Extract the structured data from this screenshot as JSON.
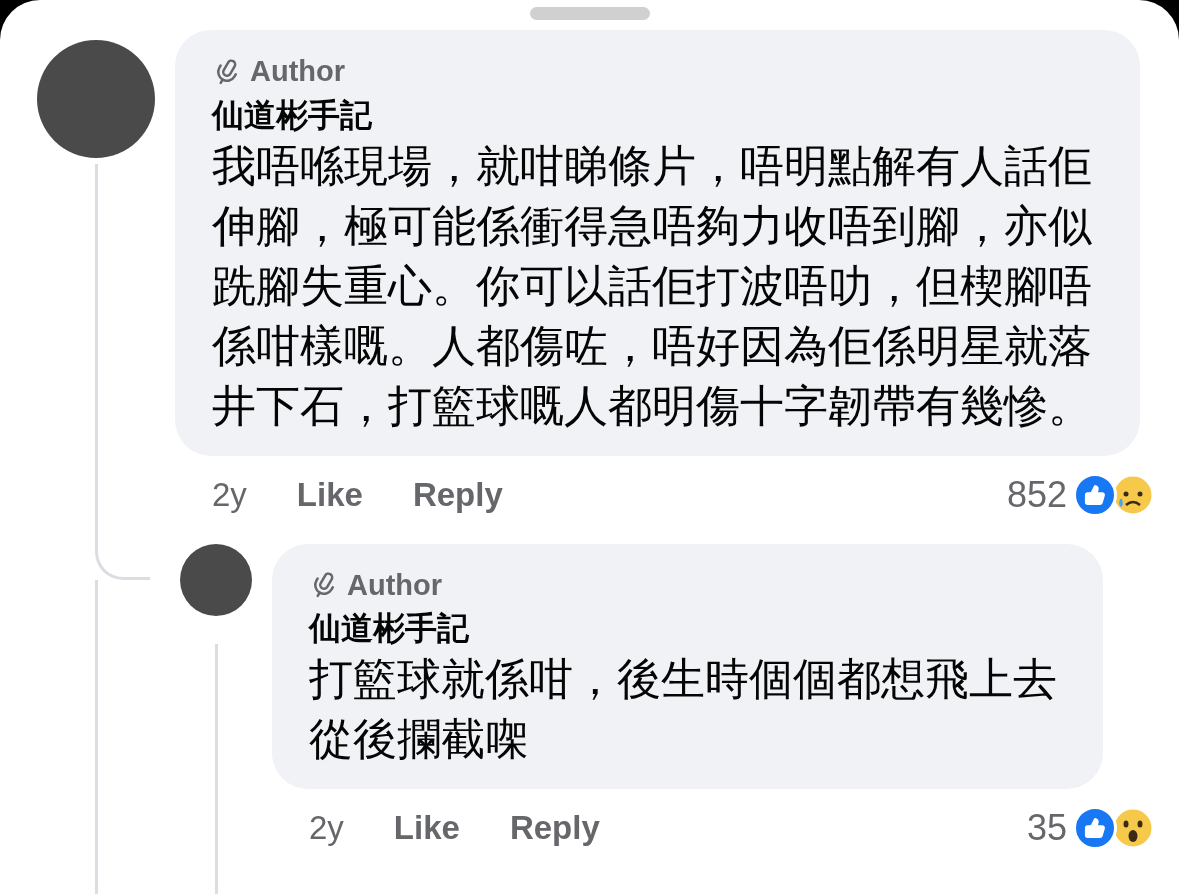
{
  "comments": [
    {
      "badge": "Author",
      "name": "仙道彬手記",
      "text": "我唔喺現場，就咁睇條片，唔明點解有人話佢伸腳，極可能係衝得急唔夠力收唔到腳，亦似跣腳失重心。你可以話佢打波唔叻，但楔腳唔係咁樣嘅。人都傷咗，唔好因為佢係明星就落井下石，打籃球嘅人都明傷十字韌帶有幾慘。",
      "time": "2y",
      "actions": [
        "Like",
        "Reply"
      ],
      "reaction_count": "852",
      "reactions": [
        {
          "kind": "like"
        },
        {
          "kind": "sad"
        }
      ],
      "replies": [
        {
          "badge": "Author",
          "name": "仙道彬手記",
          "text": "打籃球就係咁，後生時個個都想飛上去從後攔截㗎",
          "time": "2y",
          "actions": [
            "Like",
            "Reply"
          ],
          "reaction_count": "35",
          "reactions": [
            {
              "kind": "like"
            },
            {
              "kind": "wow"
            }
          ]
        }
      ]
    }
  ]
}
